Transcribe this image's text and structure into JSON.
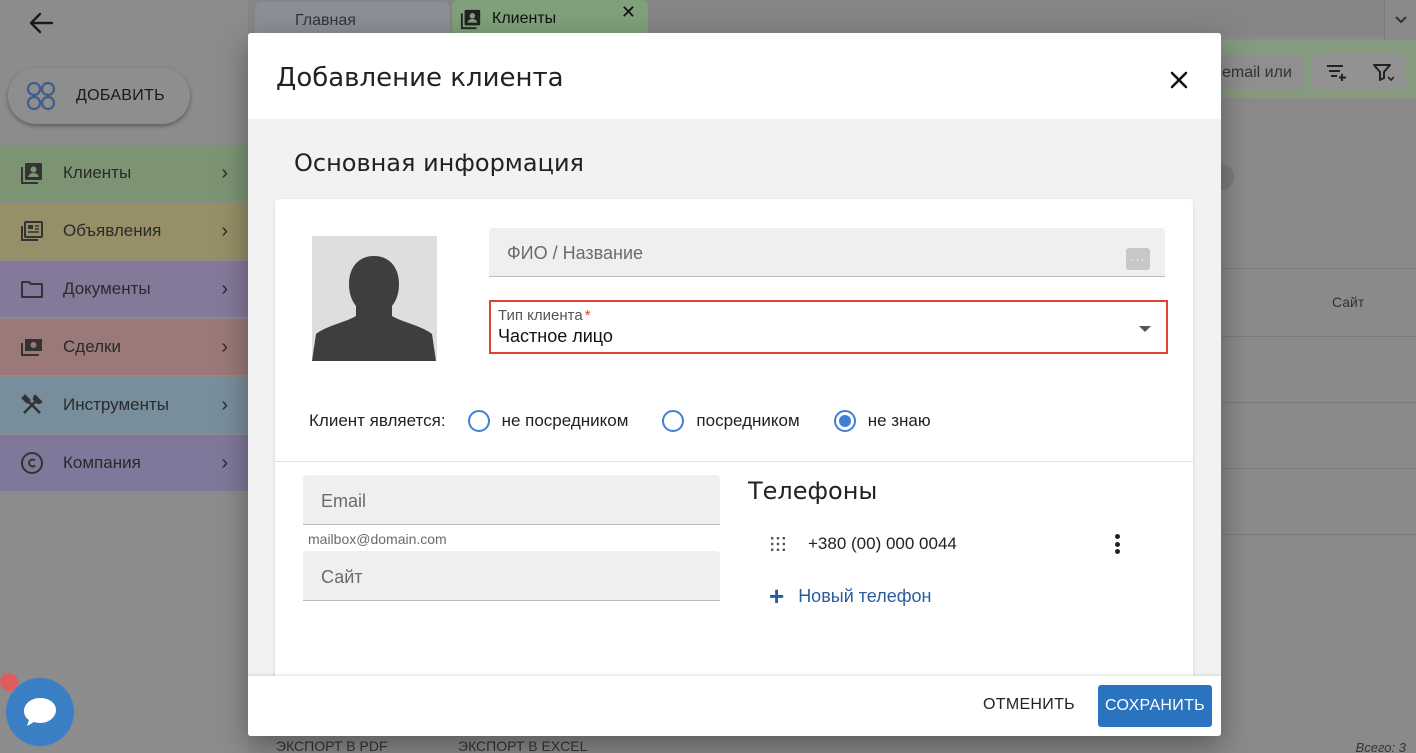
{
  "background": {
    "add_button_label": "ДОБАВИТЬ",
    "nav": [
      {
        "label": "Клиенты",
        "icon": "contacts-icon",
        "color": "#7c9474"
      },
      {
        "label": "Объявления",
        "icon": "listing-icon",
        "color": "#968f67"
      },
      {
        "label": "Документы",
        "icon": "folder-icon",
        "color": "#85799a"
      },
      {
        "label": "Сделки",
        "icon": "money-icon",
        "color": "#9a7978"
      },
      {
        "label": "Инструменты",
        "icon": "tools-icon",
        "color": "#788e9c"
      },
      {
        "label": "Компания",
        "icon": "copyright-icon",
        "color": "#80789a"
      }
    ],
    "tabs": [
      {
        "label": "Главная"
      },
      {
        "label": "Клиенты"
      }
    ],
    "search_partial": "email или",
    "column_site": "Сайт",
    "export_pdf": "ЭКСПОРТ В PDF",
    "export_excel": "ЭКСПОРТ В EXCEL",
    "total": "Всего: 3"
  },
  "modal": {
    "title": "Добавление клиента",
    "section_title": "Основная информация",
    "name_placeholder": "ФИО / Название",
    "client_type": {
      "label": "Тип клиента",
      "required_mark": "*",
      "value": "Частное лицо"
    },
    "intermediary": {
      "label": "Клиент является:",
      "options": [
        "не посредником",
        "посредником",
        "не знаю"
      ],
      "selected": "не знаю"
    },
    "email_placeholder": "Email",
    "email_hint": "mailbox@domain.com",
    "site_placeholder": "Сайт",
    "phones": {
      "title": "Телефоны",
      "items": [
        {
          "number": "+380 (00) 000 0044"
        }
      ],
      "add_label": "Новый телефон"
    },
    "cancel_label": "ОТМЕНИТЬ",
    "save_label": "СОХРАНИТЬ"
  }
}
